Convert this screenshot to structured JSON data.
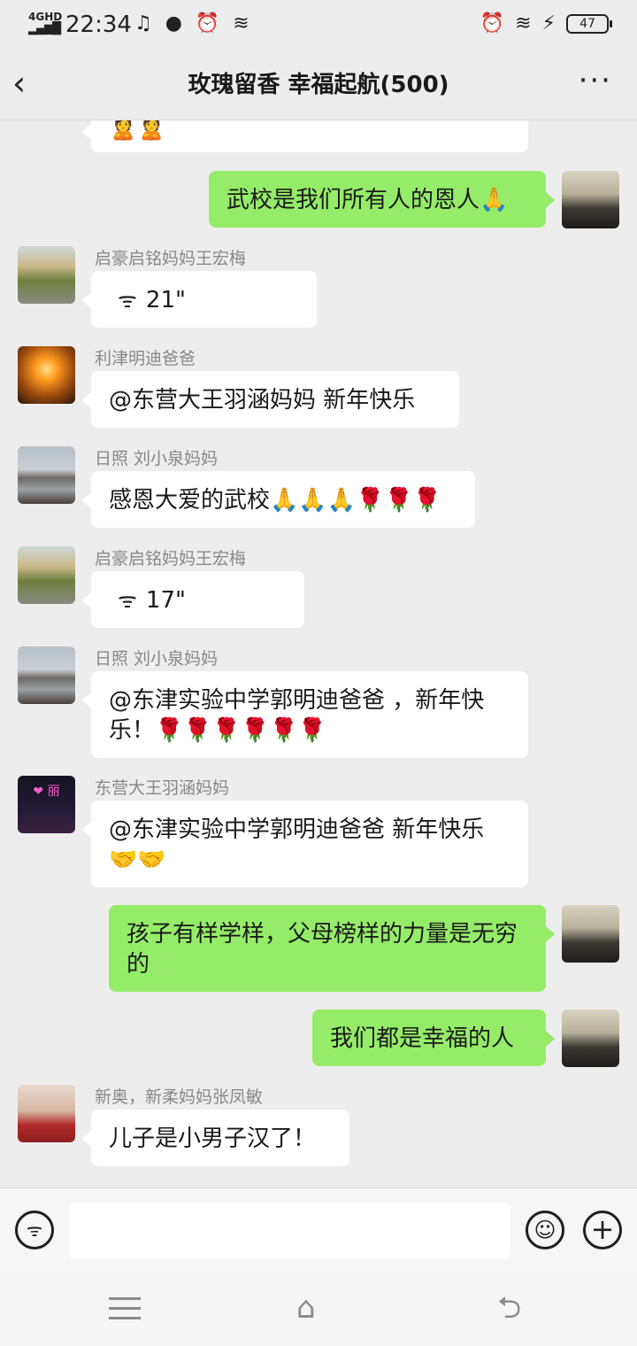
{
  "status_bar": {
    "network": "4GHD",
    "signal": "▂▄▆█",
    "time": "22:34",
    "notif_icons": "♫ ● ⏰ ≋",
    "alarm_icon": "⏰",
    "wifi_icon": "≋",
    "charge_icon": "⚡",
    "battery": "47"
  },
  "header": {
    "title": "玫瑰留香  幸福起航(500)"
  },
  "messages": [
    {
      "side": "left",
      "text": "🙎🙎"
    },
    {
      "side": "right",
      "text": "武校是我们所有人的恩人🙏"
    },
    {
      "side": "left",
      "sender": "启豪启铭妈妈王宏梅",
      "voice": "21\""
    },
    {
      "side": "left",
      "sender": "利津明迪爸爸",
      "text": "@东营大王羽涵妈妈  新年快乐"
    },
    {
      "side": "left",
      "sender": "日照  刘小泉妈妈",
      "text": "感恩大爱的武校🙏🙏🙏🌹🌹🌹"
    },
    {
      "side": "left",
      "sender": "启豪启铭妈妈王宏梅",
      "voice": "17\""
    },
    {
      "side": "left",
      "sender": "日照  刘小泉妈妈",
      "text": "@东津实验中学郭明迪爸爸 ，新年快乐！🌹🌹🌹🌹🌹🌹"
    },
    {
      "side": "left",
      "sender": "东营大王羽涵妈妈",
      "text": "@东津实验中学郭明迪爸爸  新年快乐🤝🤝",
      "avatar_text": "❤ 丽"
    },
    {
      "side": "right",
      "text": "孩子有样学样，父母榜样的力量是无穷的"
    },
    {
      "side": "right",
      "text": "我们都是幸福的人"
    },
    {
      "side": "left",
      "sender": "新奥，新柔妈妈张凤敏",
      "text": "儿子是小男子汉了！"
    }
  ],
  "input_bar": {
    "input_value": "",
    "voice_icon": "voice-toggle-icon",
    "emoji_icon": "emoji-icon",
    "plus_icon": "plus-icon"
  },
  "colors": {
    "background": "#ededed",
    "bubble_right": "#95ec69",
    "bubble_left": "#ffffff"
  }
}
